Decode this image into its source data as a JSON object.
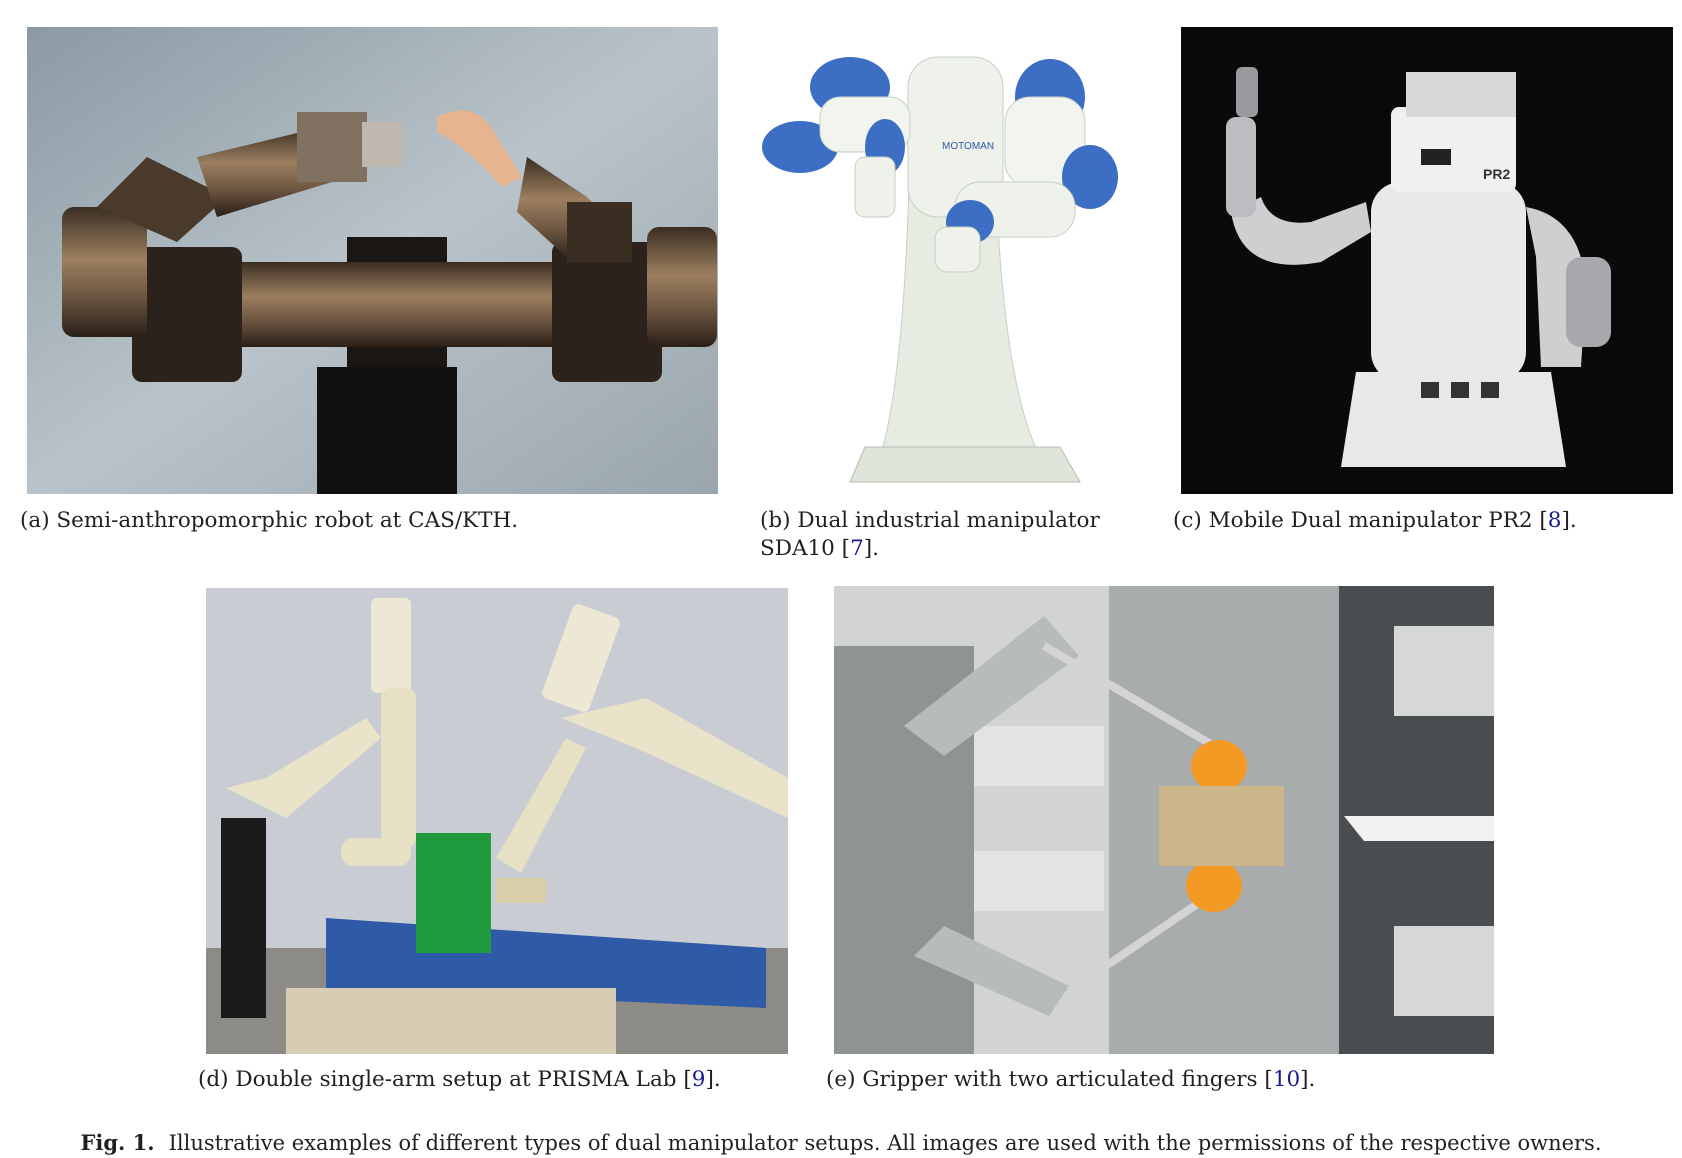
{
  "figure": {
    "label": "Fig. 1.",
    "caption": "Illustrative examples of different types of dual manipulator setups. All images are used with the permissions of the respective owners."
  },
  "panels": [
    {
      "id": "a",
      "caption": "(a) Semi-anthropomorphic robot at CAS/KTH.",
      "ref": ""
    },
    {
      "id": "b",
      "caption_line1": "(b) Dual industrial manipulator",
      "caption_line2": "SDA10 [",
      "ref": "7",
      "close": "]."
    },
    {
      "id": "c",
      "caption": "(c) Mobile Dual manipulator PR2 [",
      "ref": "8",
      "close": "]."
    },
    {
      "id": "d",
      "caption": "(d) Double single-arm setup at PRISMA Lab [",
      "ref": "9",
      "close": "]."
    },
    {
      "id": "e",
      "caption": "(e) Gripper with two articulated fingers [",
      "ref": "10",
      "close": "]."
    }
  ],
  "photo_text": {
    "motoman": "MOTOMAN",
    "pr2": "PR2"
  },
  "colors": {
    "caption_text": "#231f20",
    "reference_link": "#1a1a8c"
  }
}
